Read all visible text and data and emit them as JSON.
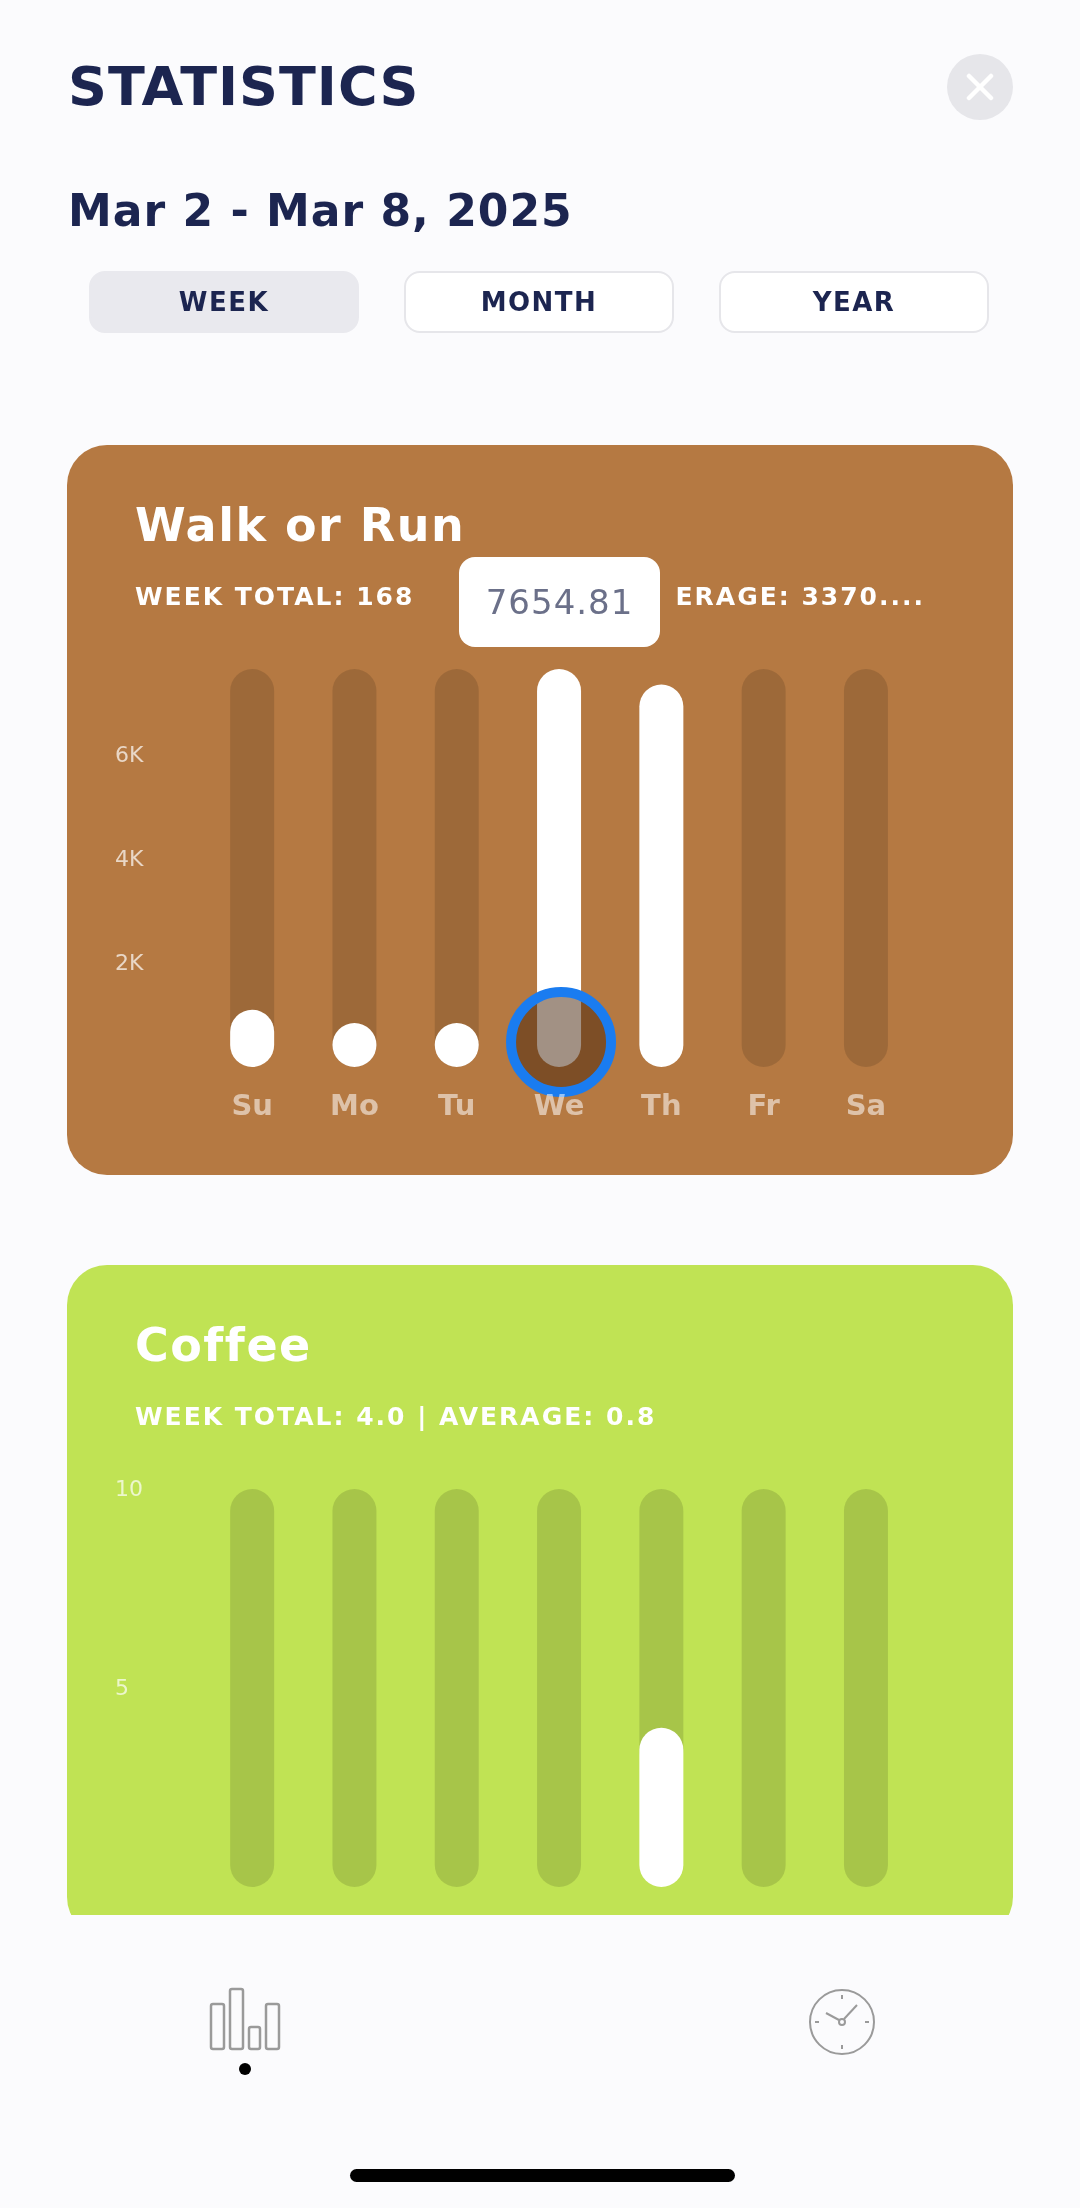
{
  "title": "STATISTICS",
  "date_range": "Mar 2 - Mar 8, 2025",
  "tabs": [
    {
      "label": "WEEK",
      "selected": true
    },
    {
      "label": "MONTH",
      "selected": false
    },
    {
      "label": "YEAR",
      "selected": false
    }
  ],
  "cards": [
    {
      "title": "Walk or Run",
      "color": "#b57942",
      "subtitle": [
        "WEEK TOTAL: 168",
        "ERAGE: 3370...."
      ],
      "tooltip": {
        "text": "7654.81"
      },
      "bar_selected": [
        false,
        false,
        false,
        true,
        false,
        false,
        false
      ],
      "chart_data": {
        "type": "bar",
        "categories": [
          "Su",
          "Mo",
          "Tu",
          "We",
          "Th",
          "Fr",
          "Sa"
        ],
        "values": [
          1100,
          840,
          840,
          7650,
          7350,
          0,
          0
        ],
        "ylim": [
          0,
          7650
        ],
        "grid": true,
        "yticks": [
          {
            "value": 2000,
            "label": "2K"
          },
          {
            "value": 4000,
            "label": "4K"
          },
          {
            "value": 6000,
            "label": "6K"
          }
        ]
      }
    },
    {
      "title": "Coffee",
      "color": "#c0e354",
      "subtitle": [
        "WEEK TOTAL: 4.0 | AVERAGE: 0.8"
      ],
      "chart_data": {
        "type": "bar",
        "values": [
          0,
          0,
          0,
          0,
          4,
          0,
          0
        ],
        "ylim": [
          0,
          10
        ],
        "grid": true,
        "yticks": [
          5,
          10
        ]
      }
    }
  ],
  "nav": [
    {
      "kind": "stats",
      "selected": true
    },
    {
      "kind": "clock",
      "selected": false
    }
  ]
}
